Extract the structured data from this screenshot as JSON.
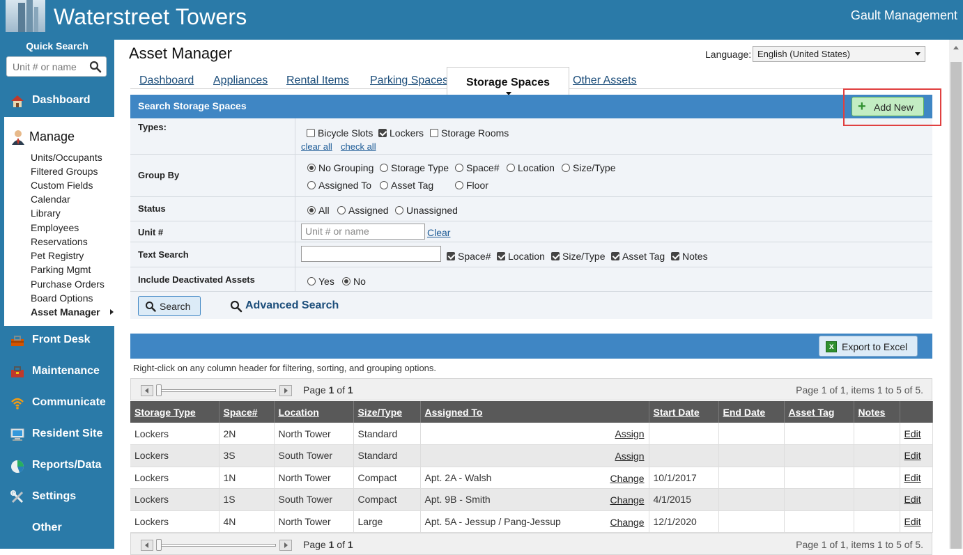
{
  "header": {
    "site_title": "Waterstreet Towers",
    "company": "Gault Management"
  },
  "sidebar": {
    "quick_search_label": "Quick Search",
    "quick_search_placeholder": "Unit # or name",
    "dashboard": "Dashboard",
    "manage": "Manage",
    "manage_items": [
      "Units/Occupants",
      "Filtered Groups",
      "Custom Fields",
      "Calendar",
      "Library",
      "Employees",
      "Reservations",
      "Pet Registry",
      "Parking Mgmt",
      "Purchase Orders",
      "Board Options",
      "Asset Manager"
    ],
    "nav_items": [
      "Front Desk",
      "Maintenance",
      "Communicate",
      "Resident Site",
      "Reports/Data",
      "Settings",
      "Other"
    ]
  },
  "page": {
    "title": "Asset Manager",
    "language_label": "Language:",
    "language_value": "English (United States)"
  },
  "tabs": {
    "dashboard": "Dashboard",
    "appliances": "Appliances",
    "rental_items": "Rental Items",
    "parking_spaces": "Parking Spaces",
    "storage_spaces": "Storage Spaces",
    "other_assets": "Other Assets"
  },
  "search": {
    "header": "Search Storage Spaces",
    "add_new": "Add New",
    "types_label": "Types:",
    "types": [
      {
        "label": "Bicycle Slots",
        "checked": false
      },
      {
        "label": "Lockers",
        "checked": true
      },
      {
        "label": "Storage Rooms",
        "checked": false
      }
    ],
    "clear_all": "clear all",
    "check_all": "check all",
    "group_by_label": "Group By",
    "group_by": [
      "No Grouping",
      "Storage Type",
      "Space#",
      "Location",
      "Size/Type",
      "Assigned To",
      "Asset Tag",
      "Floor"
    ],
    "group_by_selected": "No Grouping",
    "status_label": "Status",
    "status": [
      "All",
      "Assigned",
      "Unassigned"
    ],
    "status_selected": "All",
    "unit_label": "Unit #",
    "unit_placeholder": "Unit # or name",
    "unit_clear": "Clear",
    "text_search_label": "Text Search",
    "text_fields": [
      "Space#",
      "Location",
      "Size/Type",
      "Asset Tag",
      "Notes"
    ],
    "deactivated_label": "Include Deactivated Assets",
    "deactivated_options": [
      "Yes",
      "No"
    ],
    "deactivated_selected": "No",
    "search_button": "Search",
    "advanced_search": "Advanced Search"
  },
  "grid": {
    "export": "Export to Excel",
    "hint": "Right-click on any column header for filtering, sorting, and grouping options.",
    "page_prefix": "Page",
    "page_num": "1",
    "page_of": "of",
    "page_total": "1",
    "info_text": "Page 1 of 1, items 1 to 5 of 5.",
    "columns": [
      "Storage Type",
      "Space#",
      "Location",
      "Size/Type",
      "Assigned To",
      "Start Date",
      "End Date",
      "Asset Tag",
      "Notes",
      ""
    ],
    "rows": [
      {
        "type": "Lockers",
        "space": "2N",
        "location": "North Tower",
        "size": "Standard",
        "assigned": "",
        "action": "Assign",
        "start": "",
        "end": "",
        "tag": "",
        "notes": "",
        "edit": "Edit"
      },
      {
        "type": "Lockers",
        "space": "3S",
        "location": "South Tower",
        "size": "Standard",
        "assigned": "",
        "action": "Assign",
        "start": "",
        "end": "",
        "tag": "",
        "notes": "",
        "edit": "Edit"
      },
      {
        "type": "Lockers",
        "space": "1N",
        "location": "North Tower",
        "size": "Compact",
        "assigned": "Apt. 2A - Walsh",
        "action": "Change",
        "start": "10/1/2017",
        "end": "",
        "tag": "",
        "notes": "",
        "edit": "Edit"
      },
      {
        "type": "Lockers",
        "space": "1S",
        "location": "South Tower",
        "size": "Compact",
        "assigned": "Apt. 9B - Smith",
        "action": "Change",
        "start": "4/1/2015",
        "end": "",
        "tag": "",
        "notes": "",
        "edit": "Edit"
      },
      {
        "type": "Lockers",
        "space": "4N",
        "location": "North Tower",
        "size": "Large",
        "assigned": "Apt. 5A - Jessup / Pang-Jessup",
        "action": "Change",
        "start": "12/1/2020",
        "end": "",
        "tag": "",
        "notes": "",
        "edit": "Edit"
      }
    ]
  }
}
